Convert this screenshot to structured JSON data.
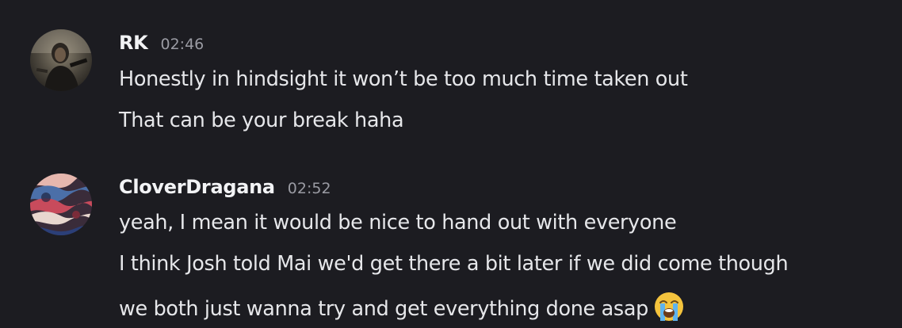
{
  "messages": [
    {
      "author": "RK",
      "time": "02:46",
      "avatar_icon": "avatar-rk-photo",
      "lines": [
        "Honestly in hindsight it won’t be too much time taken out",
        "That can be your break haha"
      ]
    },
    {
      "author": "CloverDragana",
      "time": "02:52",
      "avatar_icon": "avatar-cloverdragana-abstract",
      "lines": [
        "yeah, I mean it would be nice to hand out with everyone",
        "I think Josh told Mai we'd get there a bit later if we did come though",
        "we both just wanna try and get everything done asap"
      ],
      "trailing_emoji": "loudly-crying-face-icon"
    }
  ]
}
